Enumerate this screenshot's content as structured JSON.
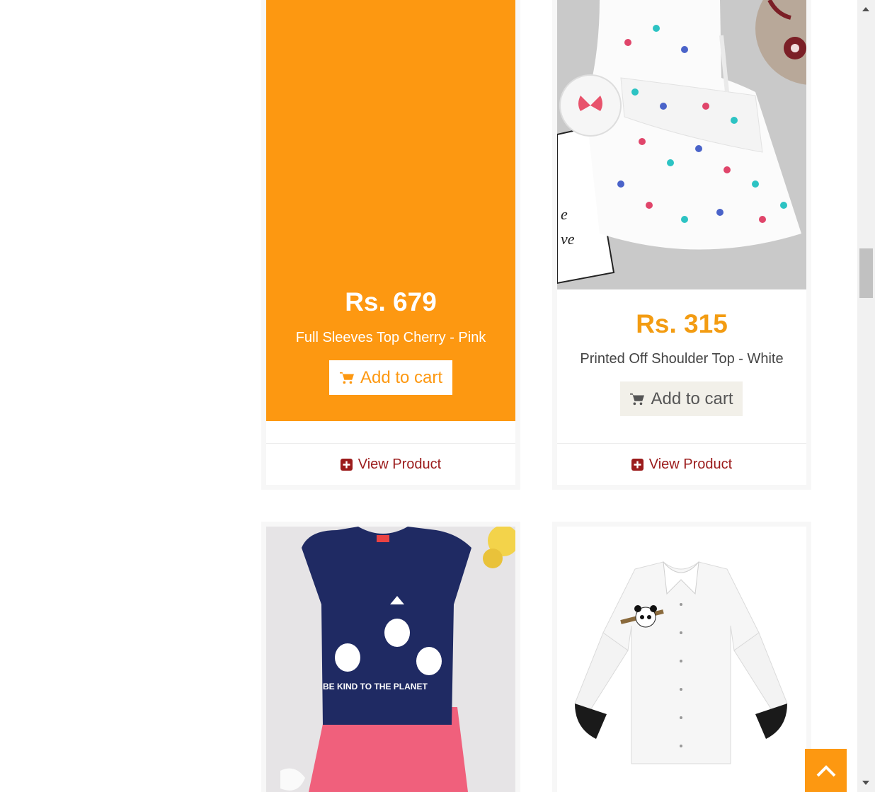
{
  "products": [
    {
      "price": "Rs. 679",
      "name": "Full Sleeves Top Cherry - Pink",
      "cart_label": "Add to cart",
      "view_label": "View Product",
      "hovered": true
    },
    {
      "price": "Rs. 315",
      "name": "Printed Off Shoulder Top - White",
      "cart_label": "Add to cart",
      "view_label": "View Product",
      "hovered": false
    }
  ],
  "lower_products": [
    {
      "image": "navy-cat-print-top-with-pink-shorts"
    },
    {
      "image": "white-shirt-with-panda-patch"
    }
  ],
  "colors": {
    "accent": "#fd9811",
    "price_orange": "#f39c12",
    "view_red": "#9b1b1b",
    "cart_bg": "#f2f0e9"
  },
  "icons": {
    "cart": "shopping-cart-icon",
    "view": "plus-square-icon",
    "back_to_top": "chevron-up-icon"
  }
}
